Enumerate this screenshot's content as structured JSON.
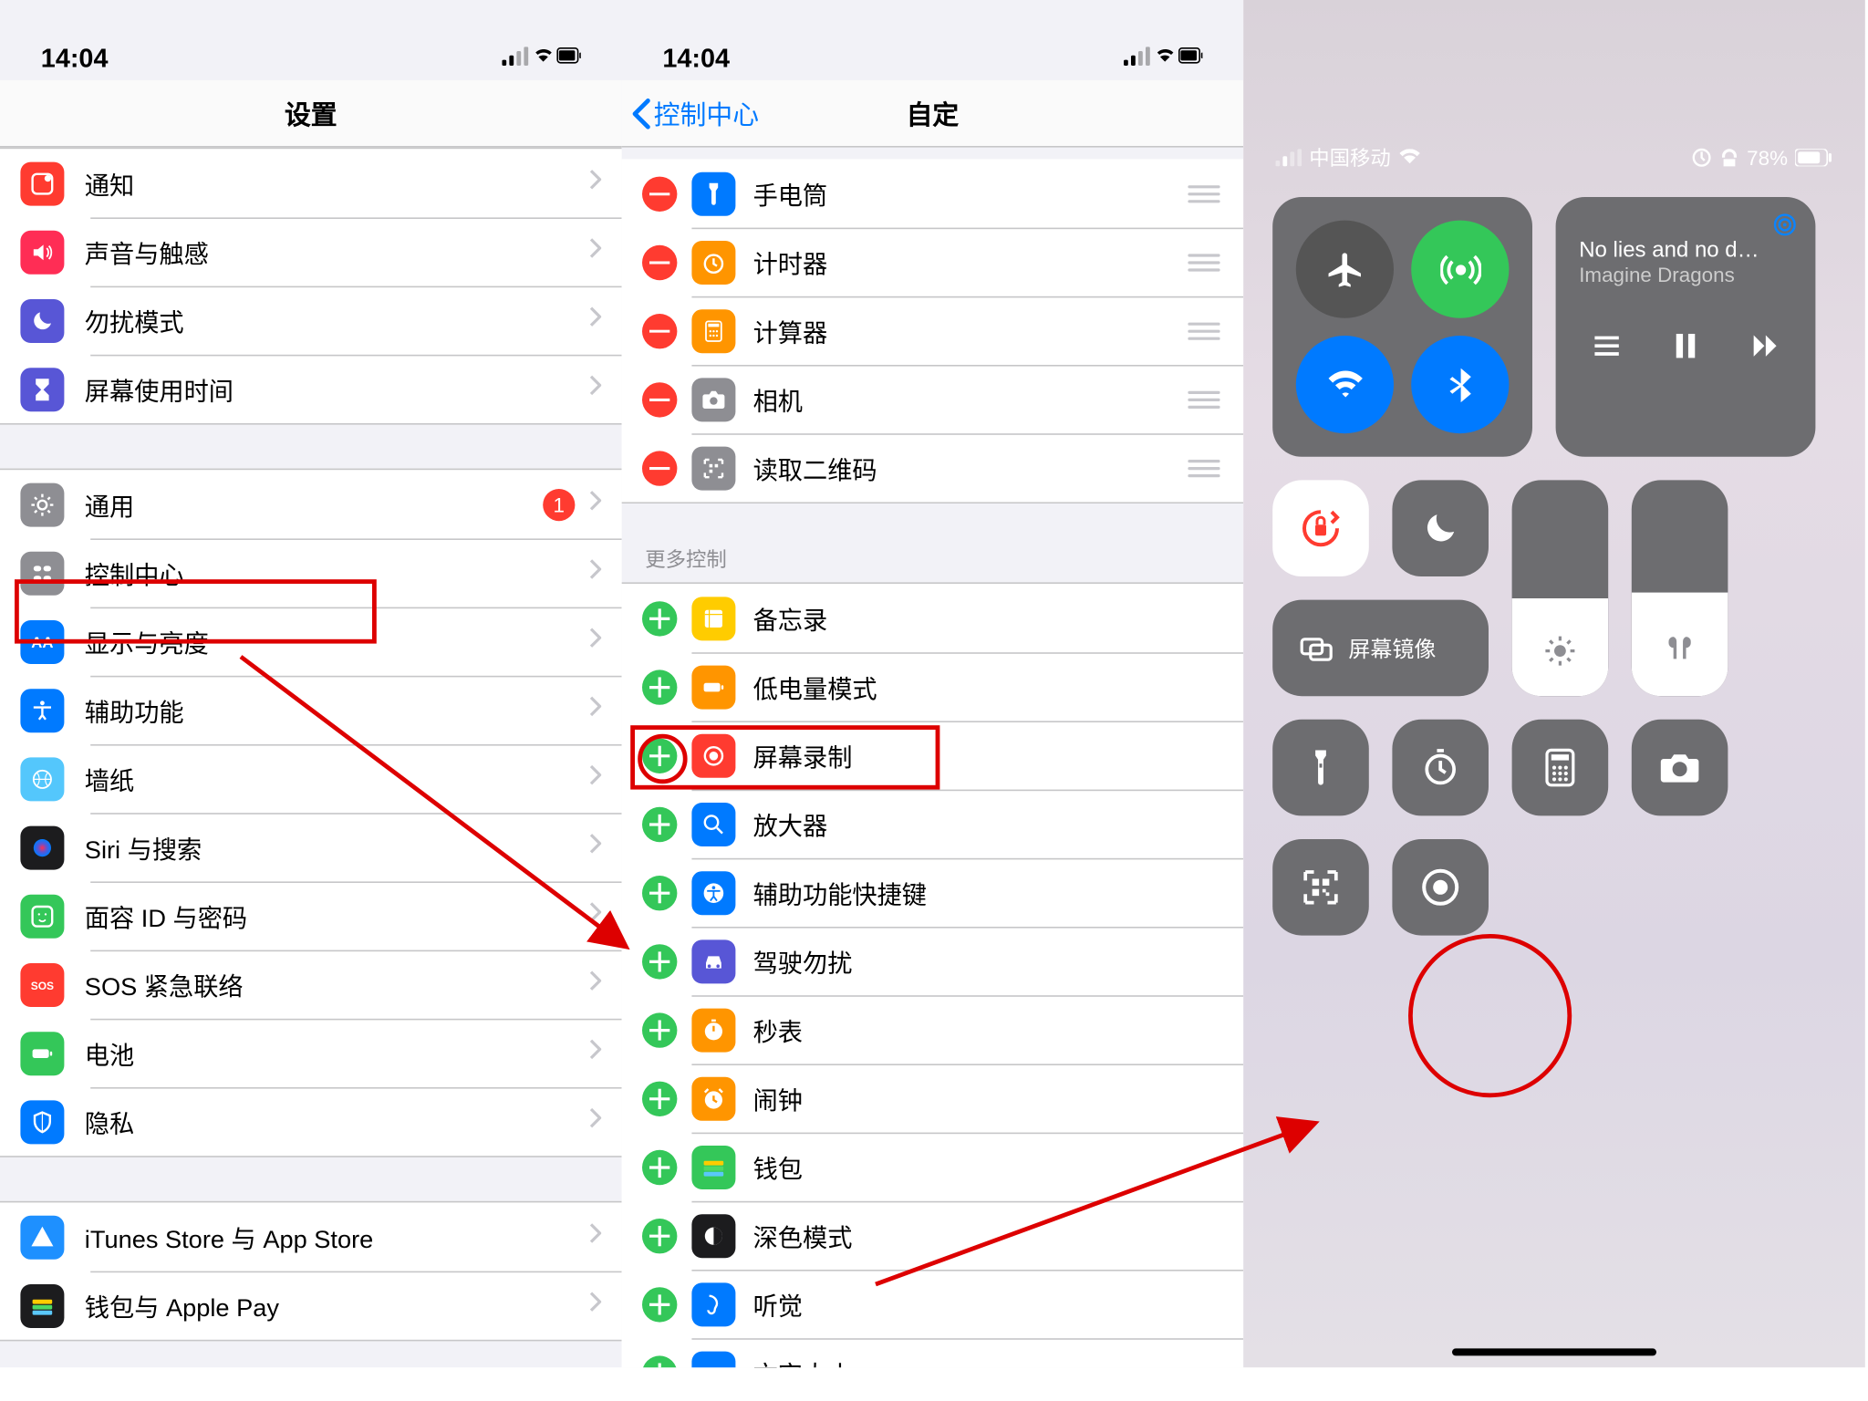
{
  "statusbar": {
    "time": "14:04"
  },
  "screen1": {
    "title": "设置",
    "groups": [
      [
        {
          "key": "notifications",
          "label": "通知",
          "color": "#ff3b30"
        },
        {
          "key": "sounds",
          "label": "声音与触感",
          "color": "#ff2d55"
        },
        {
          "key": "dnd",
          "label": "勿扰模式",
          "color": "#5856d6"
        },
        {
          "key": "screentime",
          "label": "屏幕使用时间",
          "color": "#5856d6"
        }
      ],
      [
        {
          "key": "general",
          "label": "通用",
          "color": "#8e8e93",
          "badge": "1"
        },
        {
          "key": "control-center",
          "label": "控制中心",
          "color": "#8e8e93",
          "highlight": true
        },
        {
          "key": "display",
          "label": "显示与亮度",
          "color": "#007aff"
        },
        {
          "key": "accessibility",
          "label": "辅助功能",
          "color": "#007aff"
        },
        {
          "key": "wallpaper",
          "label": "墙纸",
          "color": "#54c7fc"
        },
        {
          "key": "siri",
          "label": "Siri 与搜索",
          "color": "#1c1c1e"
        },
        {
          "key": "faceid",
          "label": "面容 ID 与密码",
          "color": "#34c759"
        },
        {
          "key": "sos",
          "label": "SOS 紧急联络",
          "color": "#ff3b30"
        },
        {
          "key": "battery",
          "label": "电池",
          "color": "#34c759"
        },
        {
          "key": "privacy",
          "label": "隐私",
          "color": "#007aff"
        }
      ],
      [
        {
          "key": "itunes",
          "label": "iTunes Store 与 App Store",
          "color": "#1e90ff"
        },
        {
          "key": "wallet",
          "label": "钱包与 Apple Pay",
          "color": "#1c1c1e"
        }
      ]
    ]
  },
  "screen2": {
    "back": "控制中心",
    "title": "自定",
    "included": [
      {
        "key": "flashlight",
        "label": "手电筒",
        "color": "#007aff"
      },
      {
        "key": "timer",
        "label": "计时器",
        "color": "#ff9500"
      },
      {
        "key": "calculator",
        "label": "计算器",
        "color": "#ff9500"
      },
      {
        "key": "camera",
        "label": "相机",
        "color": "#8e8e93"
      },
      {
        "key": "qr",
        "label": "读取二维码",
        "color": "#8e8e93"
      }
    ],
    "more_header": "更多控制",
    "more": [
      {
        "key": "notes",
        "label": "备忘录",
        "color": "#ffcc00"
      },
      {
        "key": "lowpower",
        "label": "低电量模式",
        "color": "#ff9500"
      },
      {
        "key": "screenrec",
        "label": "屏幕录制",
        "color": "#ff3b30",
        "highlight": true
      },
      {
        "key": "magnifier",
        "label": "放大器",
        "color": "#007aff"
      },
      {
        "key": "a11y-shortcut",
        "label": "辅助功能快捷键",
        "color": "#007aff"
      },
      {
        "key": "driving-dnd",
        "label": "驾驶勿扰",
        "color": "#5856d6"
      },
      {
        "key": "stopwatch",
        "label": "秒表",
        "color": "#ff9500"
      },
      {
        "key": "alarm",
        "label": "闹钟",
        "color": "#ff9500"
      },
      {
        "key": "wallet",
        "label": "钱包",
        "color": "#34c759"
      },
      {
        "key": "darkmode",
        "label": "深色模式",
        "color": "#1c1c1e"
      },
      {
        "key": "hearing",
        "label": "听觉",
        "color": "#007aff"
      },
      {
        "key": "textsize",
        "label": "文字大小",
        "color": "#007aff"
      }
    ]
  },
  "screen3": {
    "carrier": "中国移动",
    "battery": "78%",
    "media": {
      "title": "No lies and no d…",
      "subtitle": "Imagine Dragons"
    },
    "mirror": "屏幕镜像",
    "tiles": [
      {
        "key": "flashlight"
      },
      {
        "key": "timer"
      },
      {
        "key": "calculator"
      },
      {
        "key": "camera"
      },
      {
        "key": "qr"
      },
      {
        "key": "screenrec",
        "highlight": true
      }
    ]
  }
}
